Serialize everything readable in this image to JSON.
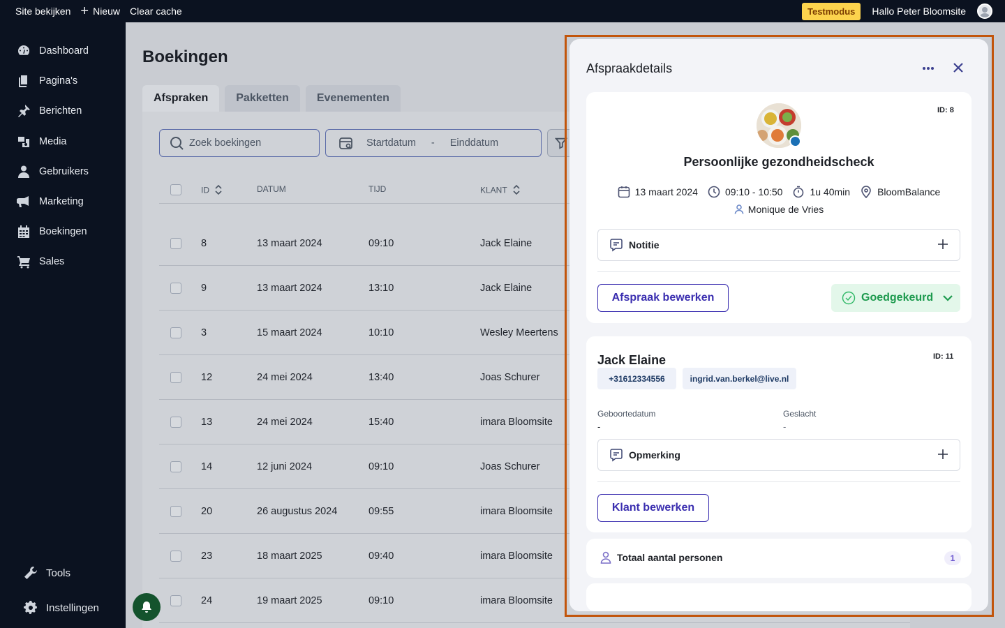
{
  "topbar": {
    "view_site": "Site bekijken",
    "new": "Nieuw",
    "clear_cache": "Clear cache",
    "test_mode": "Testmodus",
    "greeting": "Hallo Peter Bloomsite"
  },
  "sidebar": {
    "items": [
      {
        "label": "Dashboard",
        "icon": "dashboard-icon"
      },
      {
        "label": "Pagina's",
        "icon": "pages-icon"
      },
      {
        "label": "Berichten",
        "icon": "pin-icon"
      },
      {
        "label": "Media",
        "icon": "media-icon"
      },
      {
        "label": "Gebruikers",
        "icon": "user-icon"
      },
      {
        "label": "Marketing",
        "icon": "megaphone-icon"
      },
      {
        "label": "Boekingen",
        "icon": "calendar-icon"
      },
      {
        "label": "Sales",
        "icon": "cart-icon"
      }
    ],
    "bottom": [
      {
        "label": "Tools",
        "icon": "wrench-icon"
      },
      {
        "label": "Instellingen",
        "icon": "gear-icon"
      }
    ]
  },
  "main": {
    "title": "Boekingen",
    "tabs": [
      "Afspraken",
      "Pakketten",
      "Evenementen"
    ],
    "search_placeholder": "Zoek boekingen",
    "start_date": "Startdatum",
    "date_sep": "-",
    "end_date": "Einddatum",
    "columns": {
      "id": "ID",
      "date": "DATUM",
      "time": "TIJD",
      "client": "KLANT"
    },
    "rows": [
      {
        "id": "8",
        "date": "13 maart 2024",
        "time": "09:10",
        "client": "Jack Elaine"
      },
      {
        "id": "9",
        "date": "13 maart 2024",
        "time": "13:10",
        "client": "Jack Elaine"
      },
      {
        "id": "3",
        "date": "15 maart 2024",
        "time": "10:10",
        "client": "Wesley Meertens"
      },
      {
        "id": "12",
        "date": "24 mei 2024",
        "time": "13:40",
        "client": "Joas Schurer"
      },
      {
        "id": "13",
        "date": "24 mei 2024",
        "time": "15:40",
        "client": "imara Bloomsite"
      },
      {
        "id": "14",
        "date": "12 juni 2024",
        "time": "09:10",
        "client": "Joas Schurer"
      },
      {
        "id": "20",
        "date": "26 augustus 2024",
        "time": "09:55",
        "client": "imara Bloomsite"
      },
      {
        "id": "23",
        "date": "18 maart 2025",
        "time": "09:40",
        "client": "imara Bloomsite"
      },
      {
        "id": "24",
        "date": "19 maart 2025",
        "time": "09:10",
        "client": "imara Bloomsite"
      }
    ]
  },
  "drawer": {
    "title": "Afspraakdetails",
    "appointment": {
      "id_label": "ID: 8",
      "service": "Persoonlijke gezondheidscheck",
      "date": "13 maart 2024",
      "time": "09:10 - 10:50",
      "duration": "1u 40min",
      "location": "BloomBalance",
      "employee": "Monique de Vries",
      "note_label": "Notitie",
      "edit_button": "Afspraak bewerken",
      "status": "Goedgekeurd"
    },
    "client": {
      "name": "Jack Elaine",
      "id_label": "ID: 11",
      "phone": "+31612334556",
      "email": "ingrid.van.berkel@live.nl",
      "birthdate_label": "Geboortedatum",
      "birthdate_value": "-",
      "gender_label": "Geslacht",
      "gender_value": "-",
      "remark_label": "Opmerking",
      "edit_button": "Klant bewerken"
    },
    "persons_label": "Totaal aantal personen",
    "persons_count": "1"
  },
  "colors": {
    "sidebar_bg": "#0b1220",
    "accent": "#3b2fb0",
    "status_green": "#1d9a4e",
    "frame": "#c2550b"
  }
}
